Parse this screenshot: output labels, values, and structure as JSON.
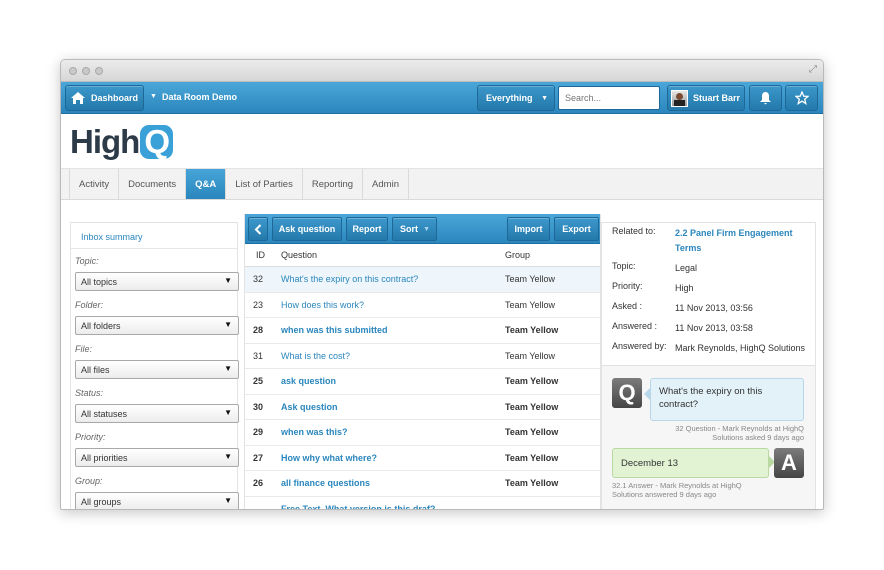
{
  "topbar": {
    "dashboard_label": "Dashboard",
    "site_name": "Data Room Demo",
    "scope_label": "Everything",
    "search_placeholder": "Search...",
    "user_name": "Stuart Barr"
  },
  "logo": {
    "text_main": "High",
    "text_q": "Q"
  },
  "tabs": [
    {
      "label": "Activity",
      "active": false
    },
    {
      "label": "Documents",
      "active": false
    },
    {
      "label": "Q&A",
      "active": true
    },
    {
      "label": "List of Parties",
      "active": false
    },
    {
      "label": "Reporting",
      "active": false
    },
    {
      "label": "Admin",
      "active": false
    }
  ],
  "sidebar": {
    "inbox_label": "Inbox summary",
    "filters": [
      {
        "label": "Topic:",
        "value": "All topics"
      },
      {
        "label": "Folder:",
        "value": "All folders"
      },
      {
        "label": "File:",
        "value": "All files"
      },
      {
        "label": "Status:",
        "value": "All statuses"
      },
      {
        "label": "Priority:",
        "value": "All priorities"
      },
      {
        "label": "Group:",
        "value": "All groups"
      }
    ]
  },
  "toolbar": {
    "ask_label": "Ask question",
    "report_label": "Report",
    "sort_label": "Sort",
    "import_label": "Import",
    "export_label": "Export"
  },
  "table": {
    "headers": {
      "id": "ID",
      "question": "Question",
      "group": "Group"
    },
    "rows": [
      {
        "id": "32",
        "question": "What's the expiry on this contract?",
        "group": "Team Yellow",
        "unread": false,
        "selected": true
      },
      {
        "id": "23",
        "question": "How does this work?",
        "group": "Team Yellow",
        "unread": false,
        "selected": false
      },
      {
        "id": "28",
        "question": "when was this submitted",
        "group": "Team Yellow",
        "unread": true,
        "selected": false
      },
      {
        "id": "31",
        "question": "What is the cost?",
        "group": "Team Yellow",
        "unread": false,
        "selected": false
      },
      {
        "id": "25",
        "question": "ask question",
        "group": "Team Yellow",
        "unread": true,
        "selected": false
      },
      {
        "id": "30",
        "question": "Ask question",
        "group": "Team Yellow",
        "unread": true,
        "selected": false
      },
      {
        "id": "29",
        "question": "when was this?",
        "group": "Team Yellow",
        "unread": true,
        "selected": false
      },
      {
        "id": "27",
        "question": "How why what where?",
        "group": "Team Yellow",
        "unread": true,
        "selected": false
      },
      {
        "id": "26",
        "question": "all finance questions",
        "group": "Team Yellow",
        "unread": true,
        "selected": false
      },
      {
        "id": "",
        "question": "Free Text, What version is this draf?",
        "group": "",
        "unread": true,
        "selected": false
      }
    ]
  },
  "details": {
    "related_label": "Related to:",
    "related_value": "2.2 Panel Firm Engagement Terms",
    "topic_label": "Topic:",
    "topic_value": "Legal",
    "priority_label": "Priority:",
    "priority_value": "High",
    "asked_label": "Asked :",
    "asked_value": "11 Nov 2013, 03:56",
    "answered_label": "Answered :",
    "answered_value": "11 Nov 2013, 03:58",
    "answered_by_label": "Answered by:",
    "answered_by_value": "Mark Reynolds, HighQ Solutions"
  },
  "thread": {
    "q_badge": "Q",
    "question_text": "What's the expiry on this contract?",
    "question_meta_1": "32 Question - Mark Reynolds at HighQ",
    "question_meta_2": "Solutions asked 9 days ago",
    "a_badge": "A",
    "answer_text": "December 13",
    "answer_meta_1": "32.1 Answer - Mark Reynolds at HighQ",
    "answer_meta_2": "Solutions answered 9 days ago"
  },
  "colors": {
    "accent": "#2a86bd",
    "accent_light": "#4ba6d8",
    "answer_bubble": "#e2f3d4",
    "question_bubble": "#e3f1f9"
  }
}
